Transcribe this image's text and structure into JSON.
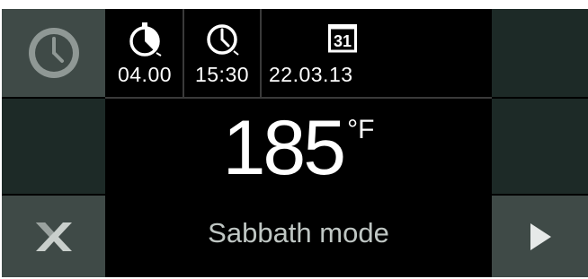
{
  "timers": {
    "duration": {
      "icon": "stopwatch-icon",
      "value": "04.00"
    },
    "end_time": {
      "icon": "clock-icon",
      "value": "15:30"
    },
    "date": {
      "icon": "calendar-icon",
      "day": "31",
      "value": "22.03.13"
    }
  },
  "display": {
    "temperature": "185",
    "unit": "°F",
    "mode_label": "Sabbath mode"
  },
  "buttons": {
    "left_top_icon": "clock-icon",
    "cancel_icon": "close-icon",
    "next_icon": "chevron-right-icon"
  },
  "colors": {
    "panel": "#3f4a47",
    "panel_dark": "#1d2a27",
    "background": "#000000",
    "text": "#ffffff",
    "mode_text": "#bfc6c3"
  }
}
